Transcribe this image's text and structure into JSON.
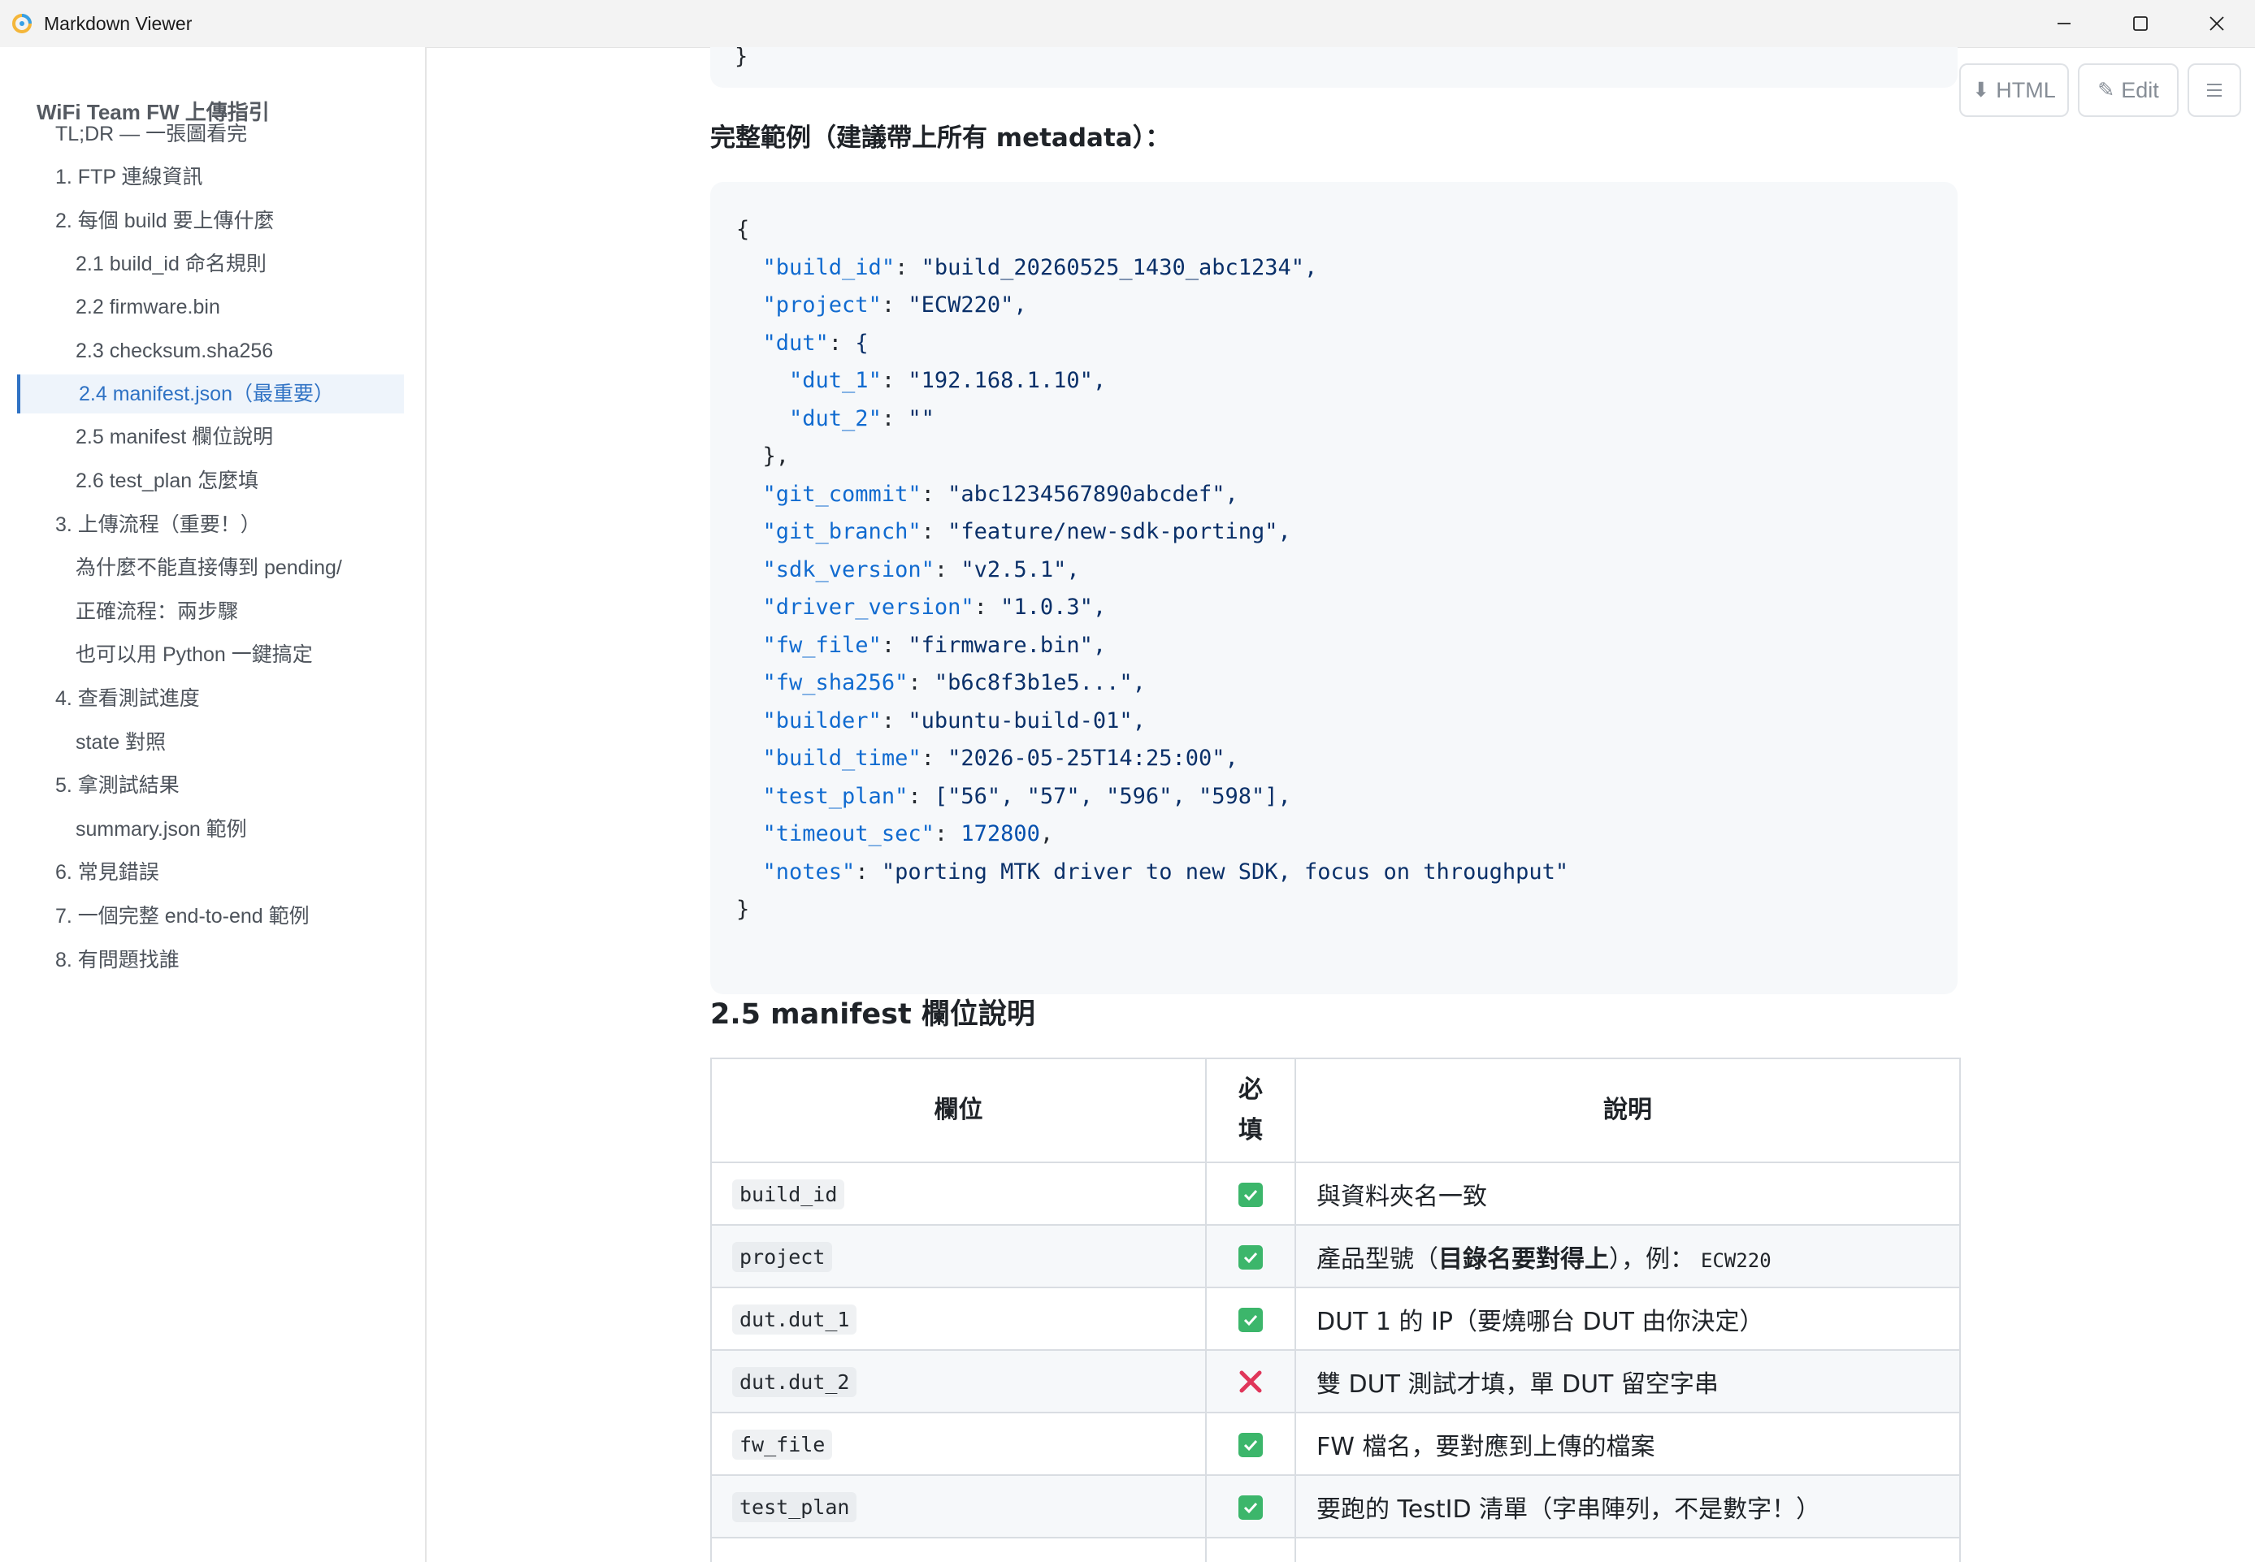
{
  "window": {
    "title": "Markdown Viewer"
  },
  "toolbar": {
    "html_label": "HTML",
    "edit_label": "Edit"
  },
  "toc": {
    "title": "WiFi Team FW 上傳指引",
    "items": [
      {
        "label": "TL;DR — 一張圖看完",
        "level": 1
      },
      {
        "label": "1. FTP 連線資訊",
        "level": 1
      },
      {
        "label": "2. 每個 build 要上傳什麼",
        "level": 1
      },
      {
        "label": "2.1 build_id 命名規則",
        "level": 2
      },
      {
        "label": "2.2 firmware.bin",
        "level": 2
      },
      {
        "label": "2.3 checksum.sha256",
        "level": 2
      },
      {
        "label": "2.4 manifest.json（最重要）",
        "level": 2,
        "active": true
      },
      {
        "label": "2.5 manifest 欄位說明",
        "level": 2
      },
      {
        "label": "2.6 test_plan 怎麼填",
        "level": 2
      },
      {
        "label": "3. 上傳流程（重要！）",
        "level": 1
      },
      {
        "label": "為什麼不能直接傳到 pending/",
        "level": 2
      },
      {
        "label": "正確流程：兩步驟",
        "level": 2
      },
      {
        "label": "也可以用 Python 一鍵搞定",
        "level": 2
      },
      {
        "label": "4. 查看測試進度",
        "level": 1
      },
      {
        "label": "state 對照",
        "level": 2
      },
      {
        "label": "5. 拿測試結果",
        "level": 1
      },
      {
        "label": "summary.json 範例",
        "level": 2
      },
      {
        "label": "6. 常見錯誤",
        "level": 1
      },
      {
        "label": "7. 一個完整 end-to-end 範例",
        "level": 1
      },
      {
        "label": "8. 有問題找誰",
        "level": 1
      }
    ]
  },
  "content": {
    "prev_code_tail": "}",
    "example_heading": "完整範例（建議帶上所有 metadata）：",
    "code": {
      "open": "{",
      "close": "}",
      "lines": [
        {
          "key": "\"build_id\"",
          "value": "\"build_20260525_1430_abc1234\","
        },
        {
          "key": "\"project\"",
          "value": "\"ECW220\","
        },
        {
          "key": "\"dut\"",
          "value": "{"
        },
        {
          "key": "\"dut_1\"",
          "value": "\"192.168.1.10\",",
          "indent": 2
        },
        {
          "key": "\"dut_2\"",
          "value": "\"\"",
          "indent": 2
        },
        {
          "raw": "},"
        },
        {
          "key": "\"git_commit\"",
          "value": "\"abc1234567890abcdef\","
        },
        {
          "key": "\"git_branch\"",
          "value": "\"feature/new-sdk-porting\","
        },
        {
          "key": "\"sdk_version\"",
          "value": "\"v2.5.1\","
        },
        {
          "key": "\"driver_version\"",
          "value": "\"1.0.3\","
        },
        {
          "key": "\"fw_file\"",
          "value": "\"firmware.bin\","
        },
        {
          "key": "\"fw_sha256\"",
          "value": "\"b6c8f3b1e5...\","
        },
        {
          "key": "\"builder\"",
          "value": "\"ubuntu-build-01\","
        },
        {
          "key": "\"build_time\"",
          "value": "\"2026-05-25T14:25:00\","
        },
        {
          "key": "\"test_plan\"",
          "value": "[\"56\", \"57\", \"596\", \"598\"],"
        },
        {
          "key": "\"timeout_sec\"",
          "value": "172800",
          "numeric": true,
          "trail": ","
        },
        {
          "key": "\"notes\"",
          "value": "\"porting MTK driver to new SDK, focus on throughput\""
        }
      ]
    },
    "section_heading": "2.5 manifest 欄位說明",
    "table": {
      "headers": {
        "field": "欄位",
        "required_1": "必",
        "required_2": "填",
        "desc": "說明"
      },
      "rows": [
        {
          "field": "build_id",
          "required": true,
          "desc": "與資料夾名一致"
        },
        {
          "field": "project",
          "required": true,
          "desc_pre": "產品型號（",
          "desc_bold": "目錄名要對得上",
          "desc_post": "），例：",
          "desc_code": "ECW220"
        },
        {
          "field": "dut.dut_1",
          "required": true,
          "desc": "DUT 1 的 IP（要燒哪台 DUT 由你決定）"
        },
        {
          "field": "dut.dut_2",
          "required": false,
          "desc": "雙 DUT 測試才填，單 DUT 留空字串"
        },
        {
          "field": "fw_file",
          "required": true,
          "desc": "FW 檔名，要對應到上傳的檔案"
        },
        {
          "field": "test_plan",
          "required": true,
          "desc": "要跑的 TestID 清單（字串陣列，不是數字！）"
        }
      ]
    }
  },
  "colors": {
    "accent": "#2f72c4",
    "check": "#3cb66b",
    "cross": "#e0365a"
  }
}
